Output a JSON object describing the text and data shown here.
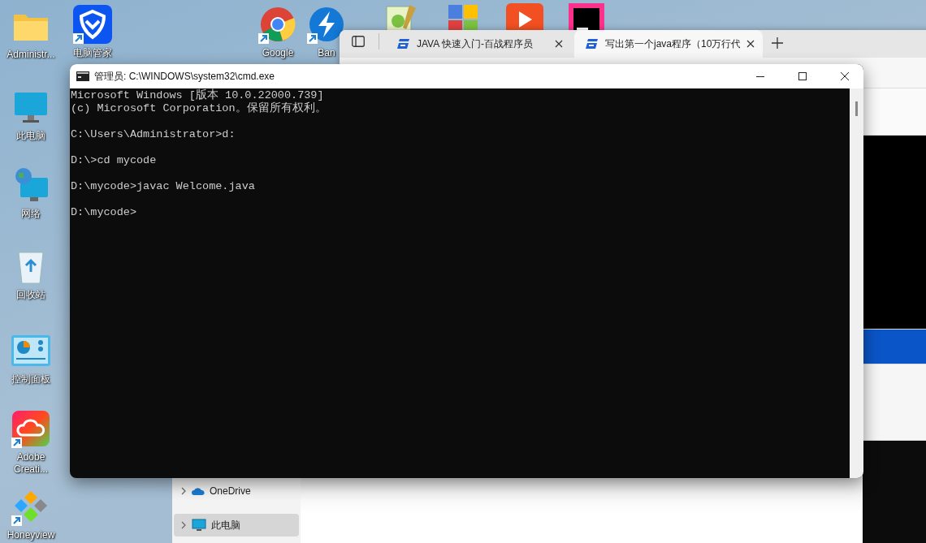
{
  "desktop": {
    "left_column": [
      {
        "label": "Administr...",
        "kind": "folder",
        "shortcut": false
      },
      {
        "label": "此电脑",
        "kind": "monitor",
        "shortcut": false
      },
      {
        "label": "网络",
        "kind": "network",
        "shortcut": false
      },
      {
        "label": "回收站",
        "kind": "recycle",
        "shortcut": false
      },
      {
        "label": "控制面板",
        "kind": "control",
        "shortcut": false
      },
      {
        "label": "Adobe Creati...",
        "kind": "cloud",
        "shortcut": true
      },
      {
        "label": "Honeyview",
        "kind": "diamonds",
        "shortcut": true
      }
    ],
    "top_row": [
      {
        "label": "电脑管家",
        "kind": "shield",
        "shortcut": true
      },
      {
        "label": "Google",
        "kind": "chrome",
        "shortcut": true
      },
      {
        "label": "Ban",
        "kind": "bolt",
        "shortcut": true
      },
      {
        "kind": "notepad",
        "shortcut": false
      },
      {
        "kind": "squares",
        "shortcut": false
      },
      {
        "kind": "play",
        "shortcut": false
      },
      {
        "kind": "ij",
        "shortcut": false
      }
    ]
  },
  "browser": {
    "tabs": [
      {
        "title": "JAVA 快速入门-百战程序员",
        "selected": false
      },
      {
        "title": "写出第一个java程序（10万行代",
        "selected": true
      }
    ]
  },
  "explorer": {
    "nav_items": [
      {
        "label": "OneDrive",
        "kind": "cloud",
        "selected": false
      },
      {
        "label": "此电脑",
        "kind": "monitor",
        "selected": true
      }
    ]
  },
  "console": {
    "title": "管理员: C:\\WINDOWS\\system32\\cmd.exe",
    "blocks": [
      [
        "Microsoft Windows [版本 10.0.22000.739]",
        "(c) Microsoft Corporation。保留所有权利。"
      ],
      [
        "C:\\Users\\Administrator>d:"
      ],
      [
        "D:\\>cd mycode"
      ],
      [
        "D:\\mycode>javac Welcome.java"
      ],
      [
        "D:\\mycode>"
      ]
    ]
  }
}
